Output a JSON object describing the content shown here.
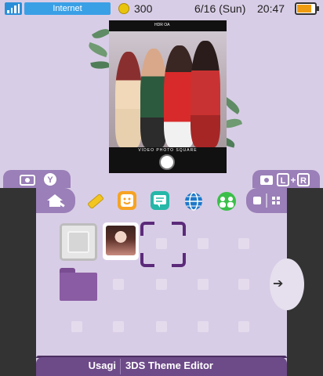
{
  "status_bar": {
    "connection": "Internet",
    "coins": "300",
    "date": "6/16 (Sun)",
    "time": "20:47",
    "battery_level": 0.8,
    "accent_color": "#3aa0e6"
  },
  "top_screen": {
    "camera_top_labels": "HDR OA",
    "camera_modes": "VIDEO   PHOTO   SQUARE",
    "left_tab_buttons": [
      "camera-icon",
      "y-button-icon"
    ],
    "right_tab_buttons": [
      "camera-icon",
      "l-button-icon",
      "plus-icon",
      "r-button-icon"
    ]
  },
  "toolbar": {
    "icons": [
      "home-settings-icon",
      "pencil-icon",
      "smiley-icon",
      "chat-icon",
      "globe-icon",
      "friends-icon"
    ],
    "view_icons": [
      "square-icon",
      "grid-icon"
    ]
  },
  "footer": {
    "user_name": "Usagi",
    "app_title": "3DS Theme Editor"
  },
  "colors": {
    "background": "#d8cde6",
    "tab": "#9a7fb8",
    "footer": "#6d4a88",
    "folder": "#8a5ca3",
    "cursor": "#5b2a7a"
  }
}
